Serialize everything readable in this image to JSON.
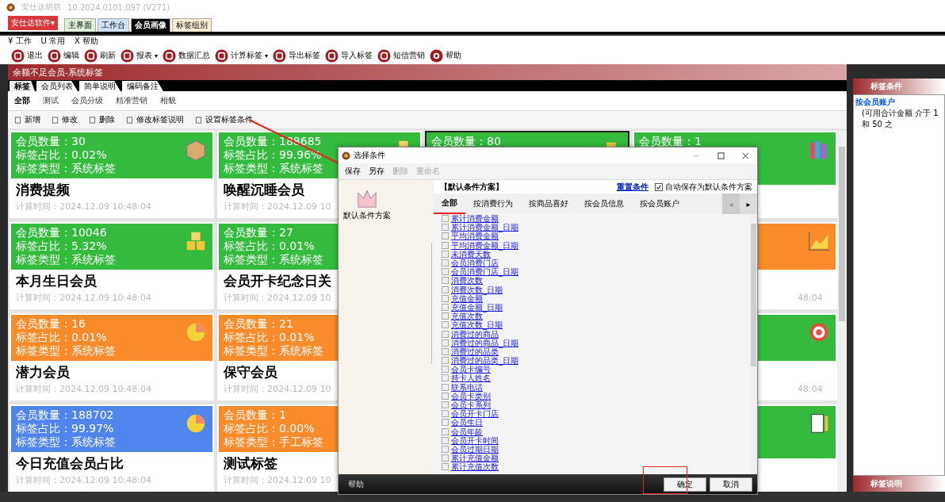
{
  "window": {
    "title": "安仕达烘焙",
    "version": "10.2024.0101.097 (V271)"
  },
  "app_menu": {
    "label": "安仕达软件",
    "caret": "▾"
  },
  "top_tabs": [
    {
      "label": "主界面",
      "selected": false,
      "color": "#dff0d8"
    },
    {
      "label": "工作台",
      "selected": false,
      "color": "#cfe2f3"
    },
    {
      "label": "会员画像",
      "selected": true,
      "color": "#000000"
    },
    {
      "label": "标签组别",
      "selected": false,
      "color": "#fbeed5"
    }
  ],
  "menu": [
    {
      "mark": "¥",
      "label": "工作"
    },
    {
      "mark": "U",
      "label": "常用"
    },
    {
      "mark": "X",
      "label": "帮助"
    }
  ],
  "toolbar": [
    {
      "label": "退出"
    },
    {
      "label": "编辑"
    },
    {
      "label": "刷新"
    },
    {
      "label": "报表",
      "caret": "▾"
    },
    {
      "label": "数据汇总"
    },
    {
      "label": "计算标签",
      "caret": "▾"
    },
    {
      "label": "导出标签"
    },
    {
      "label": "导入标签"
    },
    {
      "label": "短信营销"
    },
    {
      "label": "帮助"
    }
  ],
  "section_title": "余额不足会员-系统标签",
  "sub_tabs": [
    {
      "label": "标签",
      "selected": true
    },
    {
      "label": "会员列表",
      "selected": false
    },
    {
      "label": "简单说明",
      "selected": false
    },
    {
      "label": "编码备注",
      "selected": false
    }
  ],
  "categories": [
    {
      "label": "全部",
      "selected": true
    },
    {
      "label": "测试",
      "selected": false
    },
    {
      "label": "会员分级",
      "selected": false
    },
    {
      "label": "精准营销",
      "selected": false
    },
    {
      "label": "相貌",
      "selected": false
    }
  ],
  "actions": [
    "新增",
    "修改",
    "删除",
    "修改标签说明",
    "设置标签条件"
  ],
  "cards": [
    {
      "color": "#34bb3d",
      "count": "会员数量：30",
      "share": "标签占比：0.02%",
      "type": "标签类型：系统标签",
      "name": "消费提频",
      "time": "计算时间：2024.12.09 10:48:04",
      "selected": false
    },
    {
      "color": "#34bb3d",
      "count": "会员数量：188685",
      "share": "标签占比：99.96%",
      "type": "标签类型：系统标签",
      "name": "唤醒沉睡会员",
      "time": "计算时间：2024.12.09 10",
      "selected": false
    },
    {
      "color": "#34bb3d",
      "count": "会员数量：80",
      "selected": true
    },
    {
      "color": "#34bb3d",
      "count": "会员数量：1",
      "selected": false
    },
    {
      "color": "#34bb3d",
      "count": "会员数量：10046",
      "share": "标签占比：5.32%",
      "type": "标签类型：系统标签",
      "name": "本月生日会员",
      "time": "计算时间：2024.12.09 10:48:04",
      "selected": false
    },
    {
      "color": "#34bb3d",
      "count": "会员数量：27",
      "share": "标签占比：0.01%",
      "type": "标签类型：系统标签",
      "name": "会员开卡纪念日关",
      "time": "计算时间：2024.12.09 10",
      "selected": false
    },
    {
      "color": "#f98b2a",
      "time": "48:04",
      "selected": false
    },
    {
      "color": "#f98b2a",
      "count": "会员数量：16",
      "share": "标签占比：0.01%",
      "type": "标签类型：系统标签",
      "name": "潜力会员",
      "time": "计算时间：2024.12.09 10:48:04",
      "selected": false
    },
    {
      "color": "#f98b2a",
      "count": "会员数量：21",
      "share": "标签占比：0.01%",
      "type": "标签类型：系统标签",
      "name": "保守会员",
      "time": "计算时间：2024.12.09 10",
      "selected": false
    },
    {
      "color": "#34bb3d",
      "time": "48:04",
      "selected": false
    },
    {
      "color": "#4f85ec",
      "count": "会员数量：188702",
      "share": "标签占比：99.97%",
      "type": "标签类型：系统标签",
      "name": "今日充值会员占比",
      "time": "计算时间：2024.12.09 10:48:04",
      "selected": false
    },
    {
      "color": "#f98b2a",
      "count": "会员数量：1",
      "share": "标签占比：0.00%",
      "type": "标签类型：手工标签",
      "name": "测试标签",
      "time": "计算时间：2024.12.09 10",
      "selected": false
    },
    {
      "color": "#34bb3d",
      "selected": false
    }
  ],
  "right_panel": {
    "title": "标签条件",
    "group": "按会员账户",
    "condition": "(可用合计金额 介于 1和 50 之",
    "footer_title": "标签说明"
  },
  "dialog": {
    "title": "选择条件",
    "toolbar": [
      {
        "label": "保存",
        "disabled": false
      },
      {
        "label": "另存",
        "disabled": false
      },
      {
        "label": "删除",
        "disabled": true
      },
      {
        "label": "重命名",
        "disabled": true
      }
    ],
    "scheme": "默认条件方案",
    "header": "【默认条件方案】",
    "reset_link": "重置条件",
    "auto_save": {
      "label": "自动保存为默认条件方案",
      "checked": true
    },
    "tabs": [
      {
        "label": "全部",
        "selected": true
      },
      {
        "label": "按消费行为",
        "selected": false
      },
      {
        "label": "按商品喜好",
        "selected": false
      },
      {
        "label": "按会员信息",
        "selected": false
      },
      {
        "label": "按会员账户",
        "selected": false
      }
    ],
    "tab_nav": [
      {
        "label": "◂",
        "disabled": true
      },
      {
        "label": "▸",
        "disabled": false
      }
    ],
    "fields": [
      {
        "label": "累计消费金额",
        "checked": false
      },
      {
        "label": "累计消费金额_日期",
        "checked": false
      },
      {
        "label": "平均消费金额",
        "checked": false
      },
      {
        "label": "平均消费金额_日期",
        "checked": false
      },
      {
        "label": "未消费天数",
        "checked": false
      },
      {
        "label": "会员消费门店",
        "checked": false
      },
      {
        "label": "会员消费门店_日期",
        "checked": false
      },
      {
        "label": "消费次数",
        "checked": false
      },
      {
        "label": "消费次数_日期",
        "checked": false
      },
      {
        "label": "充值金额",
        "checked": false
      },
      {
        "label": "充值金额_日期",
        "checked": false
      },
      {
        "label": "充值次数",
        "checked": false
      },
      {
        "label": "充值次数_日期",
        "checked": false
      },
      {
        "label": "消费过的商品",
        "checked": false
      },
      {
        "label": "消费过的商品_日期",
        "checked": false
      },
      {
        "label": "消费过的品类",
        "checked": false
      },
      {
        "label": "消费过的品类_日期",
        "checked": false
      },
      {
        "label": "会员卡编号",
        "checked": false
      },
      {
        "label": "持卡人姓名",
        "checked": false
      },
      {
        "label": "联系电话",
        "checked": false
      },
      {
        "label": "会员卡类别",
        "checked": false
      },
      {
        "label": "会员卡系列",
        "checked": false
      },
      {
        "label": "会员开卡门店",
        "checked": false
      },
      {
        "label": "会员生日",
        "checked": false
      },
      {
        "label": "会员年龄",
        "checked": false
      },
      {
        "label": "会员开卡时间",
        "checked": false
      },
      {
        "label": "会员过期日期",
        "checked": false
      },
      {
        "label": "累计充值金额",
        "checked": false
      },
      {
        "label": "累计充值次数",
        "checked": false
      }
    ],
    "footer_help": "帮助",
    "buttons": [
      "确定",
      "取消"
    ]
  }
}
